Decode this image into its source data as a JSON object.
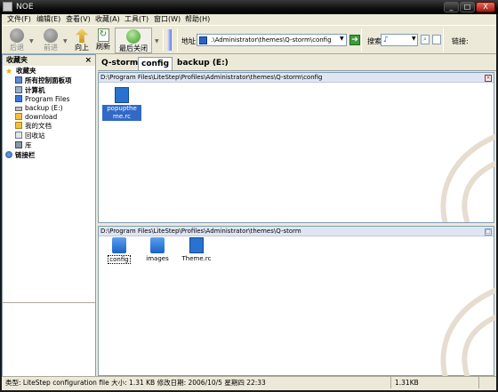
{
  "window": {
    "title": "NOE",
    "min": "_",
    "max": "□",
    "close": "X"
  },
  "menubar": [
    {
      "label": "文件(F)"
    },
    {
      "label": "编辑(E)"
    },
    {
      "label": "查看(V)"
    },
    {
      "label": "收藏(A)"
    },
    {
      "label": "工具(T)"
    },
    {
      "label": "窗口(W)"
    },
    {
      "label": "帮助(H)"
    }
  ],
  "toolbar": {
    "back": "后退",
    "forward": "前进",
    "up": "向上",
    "refresh": "刷新",
    "close_last": "最后关闭",
    "address_label": "地址:",
    "address_value": ".\\Administrator\\themes\\Q-storm\\config",
    "search_label": "搜索",
    "links_label": "链接:"
  },
  "tabs": [
    {
      "label": "Q-storm"
    },
    {
      "label": "config"
    },
    {
      "label": "backup (E:)"
    }
  ],
  "sidebar": {
    "title": "收藏夹",
    "close": "×",
    "items": [
      {
        "label": "收藏夹",
        "icon": "star-icon"
      },
      {
        "label": "所有控制面板项",
        "icon": "control-panel-icon"
      },
      {
        "label": "计算机",
        "icon": "computer-icon"
      },
      {
        "label": "Program Files",
        "icon": "folder-icon"
      },
      {
        "label": "backup (E:)",
        "icon": "drive-icon"
      },
      {
        "label": "download",
        "icon": "folder-icon"
      },
      {
        "label": "我的文档",
        "icon": "documents-icon"
      },
      {
        "label": "回收站",
        "icon": "recycle-bin-icon"
      },
      {
        "label": "库",
        "icon": "library-icon"
      },
      {
        "label": "链接栏",
        "icon": "links-icon"
      }
    ]
  },
  "pane_top": {
    "path": "D:\\Program Files\\LiteStep\\Profiles\\Administrator\\themes\\Q-storm\\config",
    "files": [
      {
        "name": "popupthe me.rc",
        "icon": "rc-file-icon",
        "selected": true
      }
    ]
  },
  "pane_bottom": {
    "path": "D:\\Program Files\\LiteStep\\Profiles\\Administrator\\themes\\Q-storm",
    "files": [
      {
        "name": "config",
        "icon": "folder-icon",
        "focused": true
      },
      {
        "name": "images",
        "icon": "folder-icon"
      },
      {
        "name": "Theme.rc",
        "icon": "rc-file-icon"
      }
    ]
  },
  "statusbar": {
    "info": "类型: LiteStep configuration file 大小: 1.31 KB 修改日期: 2006/10/5 星期四 22:33",
    "size": "1.31KB"
  },
  "colors": {
    "title_bg": "#000000",
    "chrome": "#ece9d8",
    "pane_head": "#dfe6f3",
    "selection": "#3169c6"
  }
}
